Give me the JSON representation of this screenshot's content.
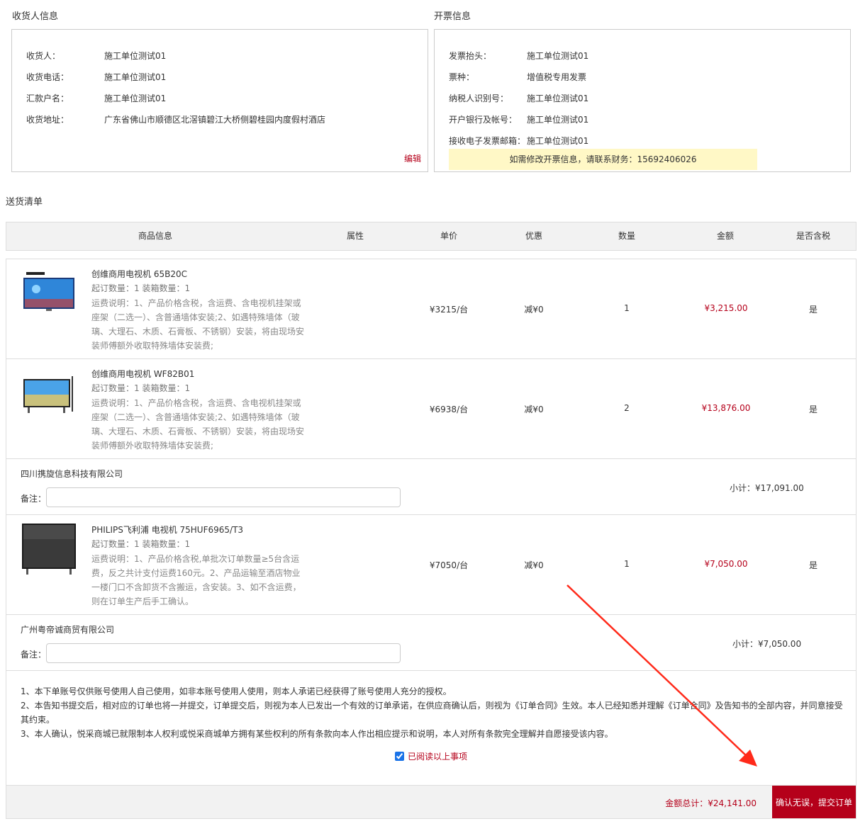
{
  "receiver": {
    "title": "收货人信息",
    "rows": [
      {
        "label": "收货人：",
        "value": "施工单位测试01"
      },
      {
        "label": "收货电话：",
        "value": "施工单位测试01"
      },
      {
        "label": "汇款户名：",
        "value": "施工单位测试01"
      },
      {
        "label": "收货地址：",
        "value": "广东省佛山市顺德区北滘镇碧江大桥侧碧桂园内度假村酒店"
      }
    ],
    "edit_label": "编辑"
  },
  "invoice": {
    "title": "开票信息",
    "rows": [
      {
        "label": "发票抬头：",
        "value": "施工单位测试01"
      },
      {
        "label": "票种：",
        "value": "增值税专用发票"
      },
      {
        "label": "纳税人识别号：",
        "value": "施工单位测试01"
      },
      {
        "label": "开户银行及帐号：",
        "value": "施工单位测试01"
      },
      {
        "label": "接收电子发票邮箱：",
        "value": "施工单位测试01"
      }
    ],
    "notice": "如需修改开票信息，请联系财务：15692406026"
  },
  "delivery": {
    "title": "送货清单",
    "headers": [
      "商品信息",
      "属性",
      "单价",
      "优惠",
      "数量",
      "金额",
      "是否含税"
    ]
  },
  "products": [
    {
      "name": "创维商用电视机 65B20C",
      "min_qty": "起订数量：1 装箱数量：1",
      "shipping": "运费说明：1、产品价格含税，含运费、含电视机挂架或座架（二选一）、含普通墙体安装;2、如遇特殊墙体（玻璃、大理石、木质、石膏板、不锈钢）安装，将由现场安装师傅额外收取特殊墙体安装费;",
      "price": "¥3215/台",
      "discount": "减¥0",
      "qty": "1",
      "amount": "¥3,215.00",
      "tax": "是"
    },
    {
      "name": "创维商用电视机 WF82B01",
      "min_qty": "起订数量：1 装箱数量：1",
      "shipping": "运费说明：1、产品价格含税，含运费、含电视机挂架或座架（二选一）、含普通墙体安装;2、如遇特殊墙体（玻璃、大理石、木质、石膏板、不锈钢）安装，将由现场安装师傅额外收取特殊墙体安装费;",
      "price": "¥6938/台",
      "discount": "减¥0",
      "qty": "2",
      "amount": "¥13,876.00",
      "tax": "是"
    },
    {
      "name": "PHILIPS飞利浦 电视机 75HUF6965/T3",
      "min_qty": "起订数量：1 装箱数量：1",
      "shipping": "运费说明：1、产品价格含税,单批次订单数量≥5台含运费，反之共计支付运费160元。2、产品运输至酒店物业一楼门口不含卸货不含搬运，含安装。3、如不含运费，则在订单生产后手工确认。",
      "price": "¥7050/台",
      "discount": "减¥0",
      "qty": "1",
      "amount": "¥7,050.00",
      "tax": "是"
    }
  ],
  "shops": [
    {
      "name": "四川携旋信息科技有限公司",
      "remark_label": "备注：",
      "subtotal": "小计：¥17,091.00"
    },
    {
      "name": "广州粤帝诚商贸有限公司",
      "remark_label": "备注：",
      "subtotal": "小计：¥7,050.00"
    }
  ],
  "terms": [
    "1、本下单账号仅供账号使用人自己使用，如非本账号使用人使用，则本人承诺已经获得了账号使用人充分的授权。",
    "2、本告知书提交后，相对应的订单也将一并提交，订单提交后，则视为本人已发出一个有效的订单承诺，在供应商确认后，则视为《订单合同》生效。本人已经知悉并理解《订单合同》及告知书的全部内容，并同意接受其约束。",
    "3、本人确认，悦采商城已就限制本人权利或悦采商城单方拥有某些权利的所有条款向本人作出相应提示和说明，本人对所有条款完全理解并自愿接受该内容。"
  ],
  "agree_label": "已阅读以上事项",
  "footer": {
    "total": "金额总计：¥24,141.00",
    "submit_label": "确认无误，提交订单"
  },
  "colors": {
    "accent": "#b5001a",
    "notice_bg": "#fff8c6",
    "arrow": "#ff2a1a"
  }
}
